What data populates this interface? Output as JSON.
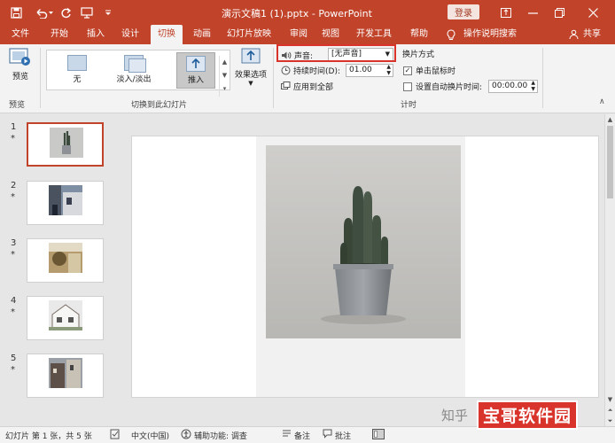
{
  "titlebar": {
    "title": "演示文稿1 (1).pptx - PowerPoint",
    "login_label": "登录",
    "bg_color": "#c0432a",
    "quick_access_icons": [
      "save-icon",
      "undo-icon",
      "redo-icon",
      "slideshow-icon"
    ],
    "window_controls": [
      "ribbon-display-icon",
      "minimize-icon",
      "restore-icon",
      "close-icon"
    ]
  },
  "tabs": [
    {
      "label": "文件"
    },
    {
      "label": "开始"
    },
    {
      "label": "插入"
    },
    {
      "label": "设计"
    },
    {
      "label": "切换",
      "active": true
    },
    {
      "label": "动画"
    },
    {
      "label": "幻灯片放映"
    },
    {
      "label": "审阅"
    },
    {
      "label": "视图"
    },
    {
      "label": "开发工具"
    },
    {
      "label": "帮助"
    }
  ],
  "tell_me": "操作说明搜索",
  "share_label": "共享",
  "ribbon": {
    "preview_button": "预览",
    "preview_group": "预览",
    "transitions": [
      {
        "label": "无"
      },
      {
        "label": "淡入/淡出"
      },
      {
        "label": "推入",
        "selected": true
      }
    ],
    "effect_options": "效果选项",
    "transition_group": "切换到此幻灯片",
    "sound_label": "声音:",
    "sound_value": "[无声音]",
    "duration_label": "持续时间(D):",
    "duration_value": "01.00",
    "apply_all": "应用到全部",
    "advance_title": "换片方式",
    "on_click_label": "单击鼠标时",
    "on_click_checked": true,
    "after_label": "设置自动换片时间:",
    "after_checked": false,
    "after_value": "00:00.00",
    "timing_group": "计时"
  },
  "slides": [
    {
      "number": "1",
      "marker": "*",
      "active": true,
      "picture": "cactus-photo"
    },
    {
      "number": "2",
      "marker": "*",
      "picture": "street-photo"
    },
    {
      "number": "3",
      "marker": "*",
      "picture": "interior-photo"
    },
    {
      "number": "4",
      "marker": "*",
      "picture": "house-photo"
    },
    {
      "number": "5",
      "marker": "*",
      "picture": "building-photo"
    }
  ],
  "statusbar": {
    "slide_info": "幻灯片 第 1 张，共 5 张",
    "language": "中文(中国)",
    "accessibility": "辅助功能: 调查",
    "notes": "备注",
    "comments": "批注"
  },
  "watermark": {
    "prefix": "知乎",
    "site": "宝哥软件园"
  }
}
